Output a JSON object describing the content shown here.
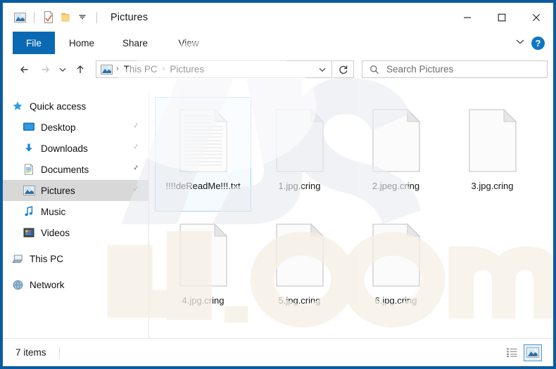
{
  "window": {
    "title": "Pictures",
    "quick_access_toolbar": [
      {
        "name": "pictures-folder-icon",
        "label": "Pictures"
      },
      {
        "name": "properties-icon",
        "label": "Properties"
      },
      {
        "name": "new-folder-icon",
        "label": "New folder"
      },
      {
        "name": "customize-qat-chevron-icon",
        "label": "Customize Quick Access Toolbar"
      }
    ],
    "controls": {
      "minimize": "–",
      "maximize": "□",
      "close": "✕"
    }
  },
  "ribbon": {
    "tabs": [
      {
        "label": "File",
        "active": true
      },
      {
        "label": "Home",
        "active": false
      },
      {
        "label": "Share",
        "active": false
      },
      {
        "label": "View",
        "active": false
      }
    ],
    "expand_label": "ˇ",
    "help_label": "?"
  },
  "addressbar": {
    "back_label": "←",
    "forward_label": "→",
    "recent_label": "ˇ",
    "up_label": "↑",
    "crumb_icon": "pictures-icon",
    "crumbs": [
      "This PC",
      "Pictures"
    ],
    "separator": "›",
    "dropdown_label": "ˇ",
    "refresh_label": "↻"
  },
  "search": {
    "placeholder": "Search Pictures",
    "icon": "search-icon"
  },
  "sidebar": {
    "items": [
      {
        "label": "Quick access",
        "icon": "star-icon",
        "type": "group",
        "pinned": false,
        "selected": false
      },
      {
        "label": "Desktop",
        "icon": "desktop-icon",
        "type": "child",
        "pinned": true,
        "selected": false
      },
      {
        "label": "Downloads",
        "icon": "download-icon",
        "type": "child",
        "pinned": true,
        "selected": false
      },
      {
        "label": "Documents",
        "icon": "documents-icon",
        "type": "child",
        "pinned": true,
        "selected": false
      },
      {
        "label": "Pictures",
        "icon": "pictures-icon",
        "type": "child",
        "pinned": true,
        "selected": true
      },
      {
        "label": "Music",
        "icon": "music-icon",
        "type": "child",
        "pinned": false,
        "selected": false
      },
      {
        "label": "Videos",
        "icon": "videos-icon",
        "type": "child",
        "pinned": false,
        "selected": false
      },
      {
        "label": "This PC",
        "icon": "this-pc-icon",
        "type": "group",
        "pinned": false,
        "selected": false
      },
      {
        "label": "Network",
        "icon": "network-icon",
        "type": "group",
        "pinned": false,
        "selected": false
      }
    ]
  },
  "files": [
    {
      "name": "!!!!deReadMe!!!.txt",
      "icon": "text-document-icon",
      "selected": true
    },
    {
      "name": "1.jpg.cring",
      "icon": "blank-document-icon",
      "selected": false
    },
    {
      "name": "2.jpeg.cring",
      "icon": "blank-document-icon",
      "selected": false
    },
    {
      "name": "3.jpg.cring",
      "icon": "blank-document-icon",
      "selected": false
    },
    {
      "name": "4.jpg.cring",
      "icon": "blank-document-icon",
      "selected": false
    },
    {
      "name": "5.jpg.cring",
      "icon": "blank-document-icon",
      "selected": false
    },
    {
      "name": "6.jpg.cring",
      "icon": "blank-document-icon",
      "selected": false
    }
  ],
  "statusbar": {
    "item_count": "7 items",
    "views": [
      {
        "name": "details-view-button",
        "active": false
      },
      {
        "name": "large-icons-view-button",
        "active": true
      }
    ]
  },
  "colors": {
    "window_border": "#0a5b9e",
    "file_tab": "#0b69b4",
    "selection_border": "#a8d2f0",
    "sidebar_selection": "#d8d8d8",
    "accent_blue": "#1076c4"
  }
}
